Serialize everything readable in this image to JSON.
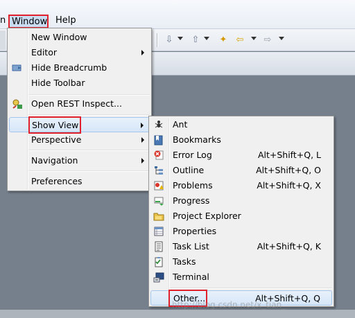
{
  "menubar": {
    "edge_label": "n",
    "window_label": "Window",
    "help_label": "Help"
  },
  "window_menu": {
    "items": [
      {
        "label": "New Window"
      },
      {
        "label": "Editor"
      },
      {
        "label": "Hide Breadcrumb",
        "icon": "breadcrumb-icon"
      },
      {
        "label": "Hide Toolbar"
      },
      {
        "label": "Open REST Inspect...",
        "icon": "rest-inspect-icon"
      },
      {
        "label": "Show View"
      },
      {
        "label": "Perspective"
      },
      {
        "label": "Navigation"
      },
      {
        "label": "Preferences"
      }
    ]
  },
  "show_view_menu": {
    "items": [
      {
        "label": "Ant",
        "shortcut": "",
        "icon": "ant-icon"
      },
      {
        "label": "Bookmarks",
        "shortcut": "",
        "icon": "bookmarks-icon"
      },
      {
        "label": "Error Log",
        "shortcut": "Alt+Shift+Q, L",
        "icon": "error-log-icon"
      },
      {
        "label": "Outline",
        "shortcut": "Alt+Shift+Q, O",
        "icon": "outline-icon"
      },
      {
        "label": "Problems",
        "shortcut": "Alt+Shift+Q, X",
        "icon": "problems-icon"
      },
      {
        "label": "Progress",
        "shortcut": "",
        "icon": "progress-icon"
      },
      {
        "label": "Project Explorer",
        "shortcut": "",
        "icon": "project-explorer-icon"
      },
      {
        "label": "Properties",
        "shortcut": "",
        "icon": "properties-icon"
      },
      {
        "label": "Task List",
        "shortcut": "Alt+Shift+Q, K",
        "icon": "task-list-icon"
      },
      {
        "label": "Tasks",
        "shortcut": "",
        "icon": "tasks-icon"
      },
      {
        "label": "Terminal",
        "shortcut": "",
        "icon": "terminal-icon"
      },
      {
        "label": "Other...",
        "shortcut": "Alt+Shift+Q, Q"
      }
    ]
  },
  "watermark": "http://blog.csdn.net/x_tian_",
  "colors": {
    "highlight_box": "#e0202a",
    "workspace_bg": "#76808d"
  }
}
